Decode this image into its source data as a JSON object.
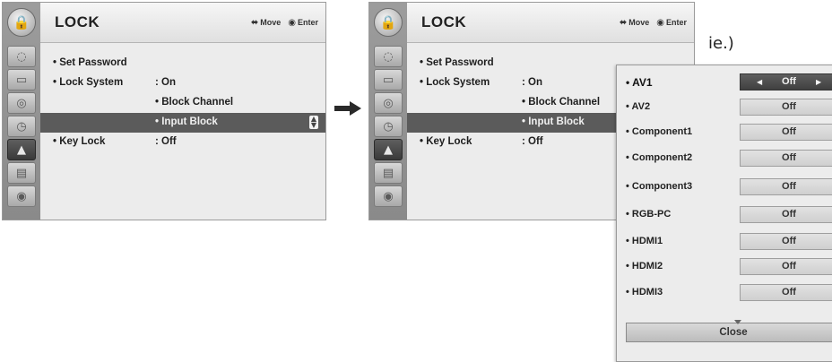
{
  "screen_left": {
    "title": "LOCK",
    "hint_move": "Move",
    "hint_enter": "Enter",
    "rows": [
      {
        "label": "• Set Password",
        "value": ""
      },
      {
        "label": "• Lock System",
        "value": ": On"
      },
      {
        "label": "",
        "value": "• Block Channel"
      },
      {
        "label": "",
        "value": "• Input Block"
      },
      {
        "label": "• Key Lock",
        "value": ": Off"
      }
    ]
  },
  "screen_right": {
    "title": "LOCK",
    "hint_move": "Move",
    "hint_enter": "Enter",
    "rows": [
      {
        "label": "• Set Password",
        "value": ""
      },
      {
        "label": "• Lock System",
        "value": ": On"
      },
      {
        "label": "",
        "value": "• Block Channel"
      },
      {
        "label": "",
        "value": "• Input Block"
      },
      {
        "label": "• Key Lock",
        "value": ": Off"
      }
    ]
  },
  "sidebar_icons": [
    "globe-icon",
    "tv-icon",
    "speaker-icon",
    "clock-icon",
    "lock-icon",
    "briefcase-icon",
    "disc-icon"
  ],
  "caption": "ie.)",
  "input_block_popup": {
    "items": [
      {
        "label": "• AV1",
        "value": "Off"
      },
      {
        "label": "• AV2",
        "value": "Off"
      },
      {
        "label": "• Component1",
        "value": "Off"
      },
      {
        "label": "• Component2",
        "value": "Off"
      },
      {
        "label": "• Component3",
        "value": "Off"
      },
      {
        "label": "• RGB-PC",
        "value": "Off"
      },
      {
        "label": "• HDMI1",
        "value": "Off"
      },
      {
        "label": "• HDMI2",
        "value": "Off"
      },
      {
        "label": "• HDMI3",
        "value": "Off"
      }
    ],
    "close_label": "Close"
  },
  "colors": {
    "selected_row": "#5b5b5b",
    "panel_bg": "#ececec",
    "sidebar_bg": "#9c9c9c"
  }
}
